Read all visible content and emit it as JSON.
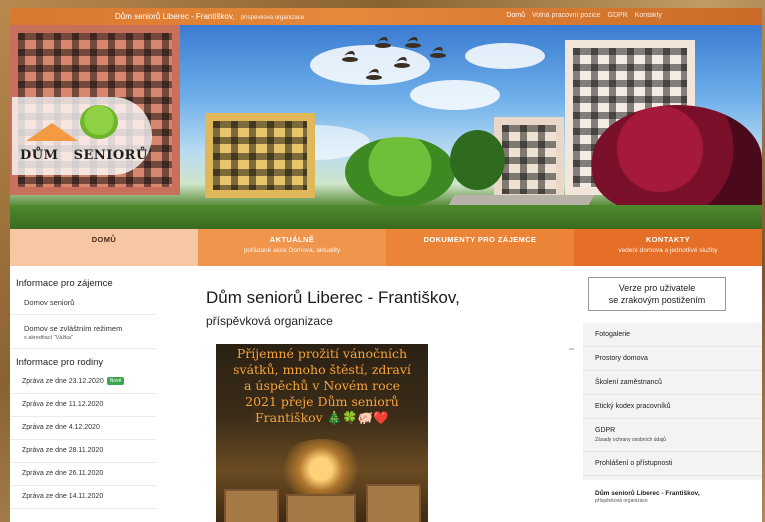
{
  "topbar": {
    "site_title": "Dům seniorů Liberec - Františkov,",
    "site_subtitle": "příspěvková organizace",
    "nav": [
      "Domů",
      "Volná pracovní pozice",
      "GDPR",
      "Kontakty"
    ]
  },
  "logo": {
    "text": "DŮM   SENIORŮ"
  },
  "mainnav": [
    {
      "label": "DOMŮ",
      "sub": ""
    },
    {
      "label": "AKTUÁLNĚ",
      "sub": "pořádané akce Domova, aktuality"
    },
    {
      "label": "DOKUMENTY PRO ZÁJEMCE",
      "sub": ""
    },
    {
      "label": "KONTAKTY",
      "sub": "vedení domova a jednotlivé služby"
    }
  ],
  "left": {
    "section1_title": "Informace pro zájemce",
    "section1_items": [
      {
        "label": "Domov seniorů",
        "sub": ""
      },
      {
        "label": "Domov se zvláštním režimem",
        "sub": "s akreditací \"Vážka\""
      }
    ],
    "section2_title": "Informace pro rodiny",
    "news": [
      {
        "label": "Zpráva ze dne 23.12.2020",
        "badge": "Nové"
      },
      {
        "label": "Zpráva ze dne 11.12.2020",
        "badge": ""
      },
      {
        "label": "Zpráva ze dne 4.12.2020",
        "badge": ""
      },
      {
        "label": "Zpráva ze dne 28.11.2020",
        "badge": ""
      },
      {
        "label": "Zpráva ze dne 26.11.2020",
        "badge": ""
      },
      {
        "label": "Zpráva ze dne 14.11.2020",
        "badge": ""
      }
    ]
  },
  "main": {
    "title": "Dům seniorů Liberec - Františkov,",
    "subtitle": "příspěvková organizace",
    "greeting_lines": [
      "Příjemné prožití vánočních",
      "svátků, mnoho štěstí, zdraví",
      "a úspěchů v Novém roce",
      "2021 přeje Dům seniorů",
      "Františkov 🎄🍀🐖❤️"
    ]
  },
  "right": {
    "access_button_line1": "Verze pro uživatele",
    "access_button_line2": "se zrakovým postižením",
    "links": [
      {
        "label": "Fotogalerie",
        "sub": ""
      },
      {
        "label": "Prostory domova",
        "sub": ""
      },
      {
        "label": "Školení zaměstnanců",
        "sub": ""
      },
      {
        "label": "Etický kodex pracovníků",
        "sub": ""
      },
      {
        "label": "GDPR",
        "sub": "Zásady ochrany osobních údajů"
      },
      {
        "label": "Prohlášení o přístupnosti",
        "sub": ""
      }
    ],
    "footer_title": "Dům seniorů Liberec - Františkov,",
    "footer_sub": "příspěvková organizace"
  },
  "colors": {
    "accent_orange": "#e6893b",
    "frame_blue": "#2a3c86",
    "badge_green": "#3aa64d",
    "greeting_text": "#f5a33b"
  }
}
